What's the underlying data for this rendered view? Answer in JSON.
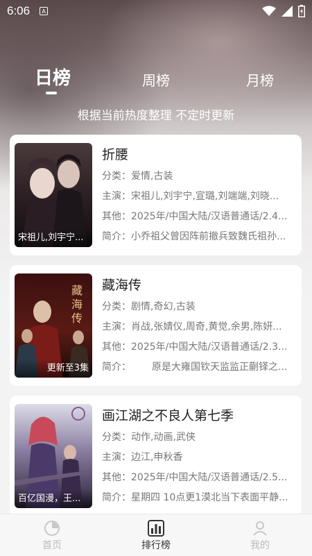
{
  "status_bar": {
    "time": "6:06",
    "notif_letter": "A"
  },
  "tabs": [
    {
      "label": "日榜",
      "active": true
    },
    {
      "label": "周榜",
      "active": false
    },
    {
      "label": "月榜",
      "active": false
    }
  ],
  "subtitle": "根据当前热度整理 不定时更新",
  "shows": [
    {
      "title": "折腰",
      "poster_caption": "宋祖儿,刘宇宁...",
      "category_key": "分类：",
      "category": "爱情,古装",
      "cast_key": "主演：",
      "cast": "宋祖儿,刘宇宁,宣璐,刘端端,刘晓...",
      "other_key": "其他：",
      "other": "2025年/中国大陆/汉语普通话/2.4...",
      "intro_key": "简介：",
      "intro": "小乔祖父曾因阵前撤兵致魏氏祖孙..."
    },
    {
      "title": "藏海传",
      "poster_caption": "更新至3集",
      "category_key": "分类：",
      "category": "剧情,奇幻,古装",
      "cast_key": "主演：",
      "cast": "肖战,张婧仪,周奇,黄觉,余男,陈妍...",
      "other_key": "其他：",
      "other": "2025年/中国大陆/汉语普通话/2.3...",
      "intro_key": "简介：",
      "intro": "原是大雍国钦天监监正蒯铎之..."
    },
    {
      "title": "画江湖之不良人第七季",
      "poster_caption": "百亿国漫，王...",
      "category_key": "分类：",
      "category": "动作,动画,武侠",
      "cast_key": "主演：",
      "cast": "边江,申秋香",
      "other_key": "其他：",
      "other": "2025年/中国大陆/汉语普通话/2.5...",
      "intro_key": "简介：",
      "intro": "星期四 10点更1漠北当下表面平静..."
    }
  ],
  "bottom_nav": [
    {
      "label": "首页",
      "icon": "home-icon"
    },
    {
      "label": "排行榜",
      "icon": "ranking-icon",
      "active": true
    },
    {
      "label": "我的",
      "icon": "profile-icon"
    }
  ]
}
